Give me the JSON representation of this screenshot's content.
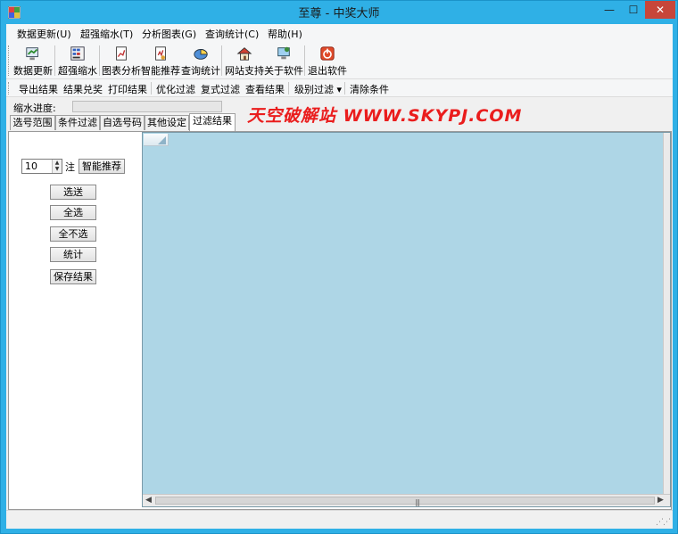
{
  "window": {
    "title": "至尊 - 中奖大师",
    "minimize": "—",
    "maximize": "☐",
    "close": "✕"
  },
  "menu": [
    "数据更新(U)",
    "超强缩水(T)",
    "分析图表(G)",
    "查询统计(C)",
    "帮助(H)"
  ],
  "toolbar": [
    {
      "label": "数据更新",
      "icon": "data-update-icon"
    },
    {
      "label": "超强缩水",
      "icon": "shrink-icon"
    },
    {
      "label": "图表分析",
      "icon": "chart-analysis-icon"
    },
    {
      "label": "智能推荐",
      "icon": "smart-recommend-icon"
    },
    {
      "label": "查询统计",
      "icon": "query-stats-icon"
    },
    {
      "label": "网站支持",
      "icon": "website-icon"
    },
    {
      "label": "关于软件",
      "icon": "about-icon"
    },
    {
      "label": "退出软件",
      "icon": "exit-icon"
    }
  ],
  "toolbar2": {
    "export": "导出结果",
    "check": "结果兑奖",
    "print": "打印结果",
    "optimize": "优化过滤",
    "compound": "复式过滤",
    "view": "查看结果",
    "level": "级别过滤",
    "level_arrow": "▾",
    "clear": "清除条件"
  },
  "progress": {
    "label": "缩水进度:",
    "value": 0
  },
  "tabs": [
    "选号范围",
    "条件过滤",
    "自选号码",
    "其他设定",
    "过滤结果"
  ],
  "active_tab": 4,
  "banner": "天空破解站 WWW.SKYPJ.COM",
  "left_panel": {
    "count_value": "10",
    "count_unit": "注",
    "recommend": "智能推荐",
    "buttons": [
      "选送",
      "全选",
      "全不选",
      "统计",
      "保存结果"
    ]
  },
  "colors": {
    "titlebar": "#2fb0e6",
    "grid_bg": "#aed6e6",
    "banner": "#ea1d1d",
    "close_button": "#c7463a"
  }
}
